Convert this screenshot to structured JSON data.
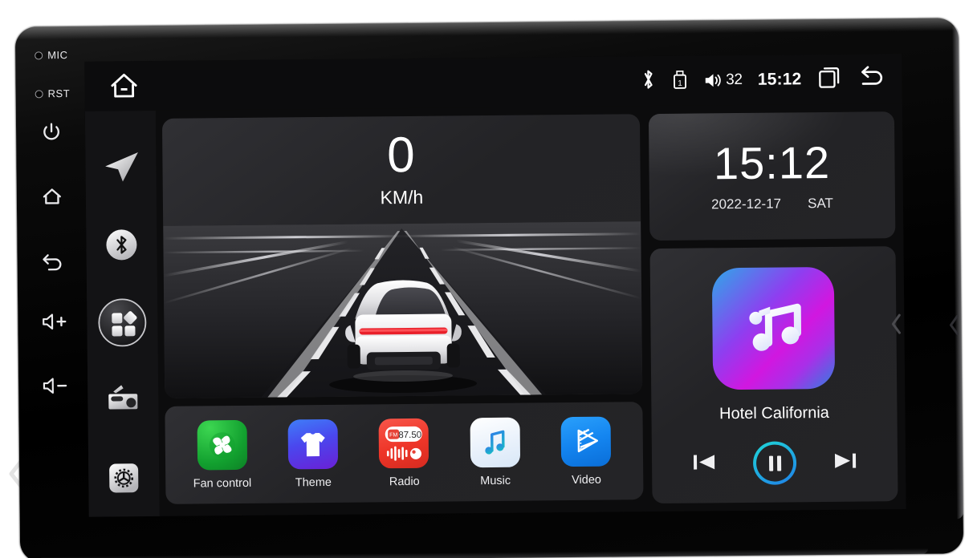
{
  "device": {
    "hardware_keys": [
      {
        "name": "mic",
        "label": "MIC",
        "type": "hole"
      },
      {
        "name": "reset",
        "label": "RST",
        "type": "hole"
      },
      {
        "name": "power",
        "label": "",
        "type": "icon"
      },
      {
        "name": "home",
        "label": "",
        "type": "icon"
      },
      {
        "name": "back",
        "label": "",
        "type": "icon"
      },
      {
        "name": "volume-up",
        "label": "",
        "type": "icon"
      },
      {
        "name": "volume-down",
        "label": "",
        "type": "icon"
      }
    ]
  },
  "statusbar": {
    "home_icon": "home-icon",
    "bluetooth_icon": "bluetooth-icon",
    "usb_icon": "usb-icon",
    "usb_label": "1",
    "volume_icon": "volume-icon",
    "volume_level": "32",
    "clock": "15:12",
    "recents_icon": "recent-apps-icon",
    "back_icon": "back-icon"
  },
  "sidebar": {
    "items": [
      {
        "name": "navigation",
        "icon": "navigation-arrow-icon",
        "selected": false
      },
      {
        "name": "bluetooth",
        "icon": "bluetooth-icon",
        "selected": false
      },
      {
        "name": "apps",
        "icon": "apps-grid-icon",
        "selected": true
      },
      {
        "name": "radio",
        "icon": "radio-icon",
        "selected": false
      },
      {
        "name": "settings",
        "icon": "settings-gear-icon",
        "selected": false
      }
    ]
  },
  "speed_widget": {
    "value": "0",
    "unit": "KM/h"
  },
  "clock_widget": {
    "time": "15:12",
    "date": "2022-12-17",
    "weekday": "SAT"
  },
  "music_widget": {
    "track_title": "Hotel California",
    "album_icon": "music-note-icon",
    "prev_label": "prev-track",
    "play_state": "pause",
    "next_label": "next-track"
  },
  "dock": {
    "apps": [
      {
        "name": "fan-control",
        "label": "Fan control",
        "icon": "fan-icon",
        "color": "#19b33a"
      },
      {
        "name": "theme",
        "label": "Theme",
        "icon": "tshirt-icon",
        "color": "#3b5bf5"
      },
      {
        "name": "radio",
        "label": "Radio",
        "icon": "radio-icon",
        "color": "#ef3c2d",
        "frequency": "87.50",
        "band": "FM"
      },
      {
        "name": "music",
        "label": "Music",
        "icon": "music-note-icon",
        "color": "#eef4fb"
      },
      {
        "name": "video",
        "label": "Video",
        "icon": "film-play-icon",
        "color": "#1485f0"
      }
    ]
  },
  "edge_controls": {
    "left_chevron": "chevron-left-icon",
    "right_chevron": "chevron-left-icon",
    "screen_chevron": "chevron-left-icon"
  },
  "colors": {
    "accent_cyan": "#1fd7d7",
    "accent_blue": "#1f7fe8",
    "panel": "#242427",
    "screen_bg": "#0c0c0d"
  }
}
